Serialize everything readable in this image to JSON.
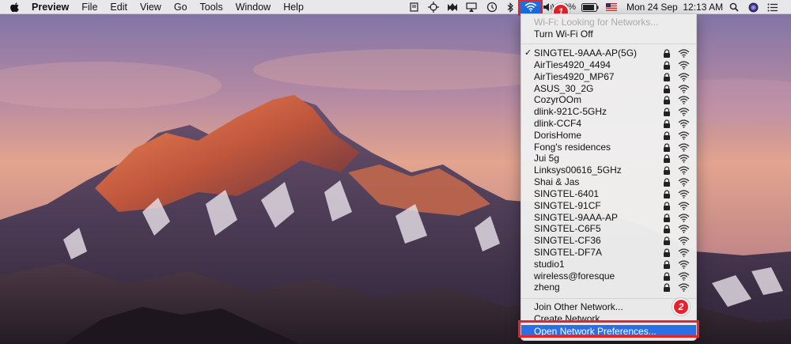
{
  "menubar": {
    "app_name": "Preview",
    "menus": [
      "File",
      "Edit",
      "View",
      "Go",
      "Tools",
      "Window",
      "Help"
    ],
    "battery_text": "80%",
    "clock": "Mon 24 Sep  12:13 AM"
  },
  "wifi_menu": {
    "status_text": "Wi-Fi: Looking for Networks...",
    "toggle_label": "Turn Wi-Fi Off",
    "connected_network": "SINGTEL-9AAA-AP(5G)",
    "networks": [
      "SINGTEL-9AAA-AP(5G)",
      "AirTies4920_4494",
      "AirTies4920_MP67",
      "ASUS_30_2G",
      "CozyrOOm",
      "dlink-921C-5GHz",
      "dlink-CCF4",
      "DorisHome",
      "Fong's residences",
      "Jui 5g",
      "Linksys00616_5GHz",
      "Shai & Jas",
      "SINGTEL-6401",
      "SINGTEL-91CF",
      "SINGTEL-9AAA-AP",
      "SINGTEL-C6F5",
      "SINGTEL-CF36",
      "SINGTEL-DF7A",
      "studio1",
      "wireless@foresque",
      "zheng"
    ],
    "join_other": "Join Other Network...",
    "create_network": "Create Network...",
    "open_prefs": "Open Network Preferences..."
  },
  "annotations": {
    "step1": "1",
    "step2": "2"
  },
  "colors": {
    "highlight": "#2a6fe6",
    "annotation_red": "#e8222a"
  }
}
